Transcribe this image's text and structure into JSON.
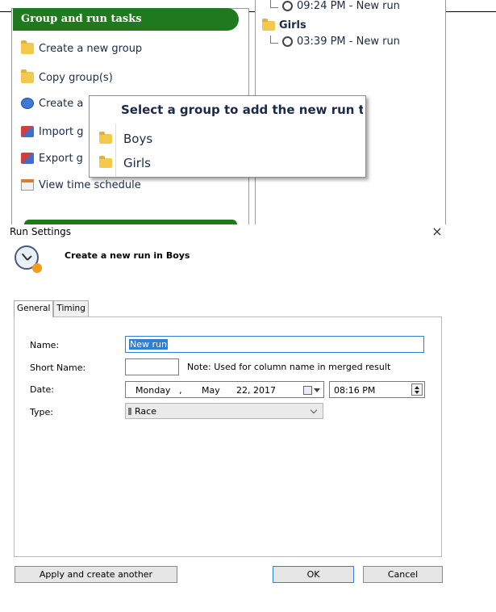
{
  "background": {
    "task_header": "Group and run tasks",
    "tasks": [
      {
        "label": "Create a new group",
        "icon": "folder-icon"
      },
      {
        "label": "Copy group(s)",
        "icon": "copy-folder-icon"
      },
      {
        "label": "Create a",
        "icon": "clock-icon"
      },
      {
        "label": "Import g",
        "icon": "import-icon"
      },
      {
        "label": "Export g",
        "icon": "export-icon"
      },
      {
        "label": "View time schedule",
        "icon": "calendar-icon"
      }
    ],
    "tree": {
      "run1": "09:24 PM - New run",
      "group_girls": "Girls",
      "run2": "03:39 PM - New run"
    },
    "popup": {
      "title": "Select a group to add the new run to",
      "items": [
        "Boys",
        "Girls"
      ]
    }
  },
  "dialog": {
    "title": "Run Settings",
    "close_glyph": "×",
    "heading": "Create a new run in Boys",
    "tabs": [
      "General",
      "Timing"
    ],
    "labels": {
      "name": "Name:",
      "short_name": "Short Name:",
      "date": "Date:",
      "type": "Type:"
    },
    "name_value": "New run",
    "short_name_value": "",
    "short_name_note": "Note: Used for column name in merged result",
    "date": {
      "weekday": "Monday",
      "sep": ",",
      "month": "May",
      "day_year": "22, 2017"
    },
    "time": "08:16 PM",
    "type_value": "Race",
    "buttons": {
      "apply": "Apply and create another",
      "ok": "OK",
      "cancel": "Cancel"
    }
  }
}
